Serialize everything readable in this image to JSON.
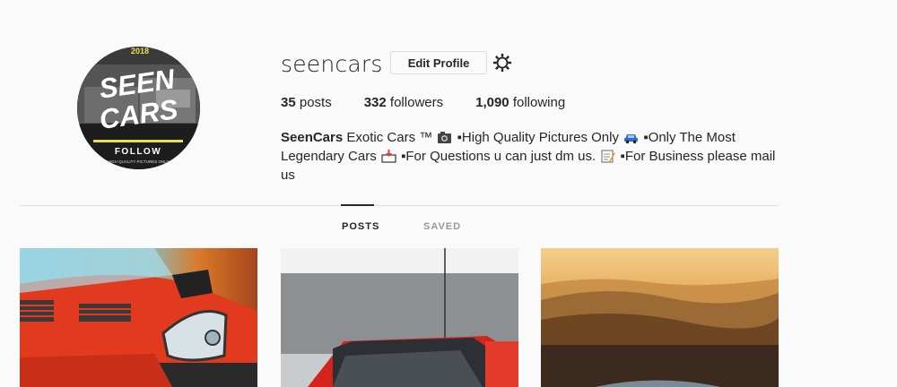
{
  "profile": {
    "username": "seencars",
    "avatar": {
      "top_text": "2018",
      "line1": "SEEN",
      "line2": "CARS",
      "follow": "FOLLOW",
      "tagline": "HIGH QUALITY PICTURES ONLY"
    },
    "edit_profile_label": "Edit Profile",
    "settings_icon": "gear-icon"
  },
  "stats": {
    "posts_count": "35",
    "posts_label": "posts",
    "followers_count": "332",
    "followers_label": "followers",
    "following_count": "1,090",
    "following_label": "following"
  },
  "bio": {
    "name": "SeenCars",
    "seg1": "Exotic Cars ™",
    "seg2": "▪High Quality Pictures Only",
    "seg3": "▪Only The Most Legendary Cars",
    "seg4": "▪For Questions u can just dm us.",
    "seg5": "▪For Business please mail us",
    "icons": [
      "camera-emoji",
      "car-emoji",
      "inbox-emoji",
      "memo-emoji"
    ]
  },
  "tabs": [
    {
      "label": "POSTS",
      "active": true
    },
    {
      "label": "SAVED",
      "active": false
    }
  ],
  "posts": [
    {
      "alt": "red-sports-car-post"
    },
    {
      "alt": "red-car-windshield-post"
    },
    {
      "alt": "sunset-hills-post"
    }
  ],
  "colors": {
    "background": "#fafafa",
    "text": "#262626",
    "muted": "#999999",
    "border": "#dbdbdb"
  }
}
